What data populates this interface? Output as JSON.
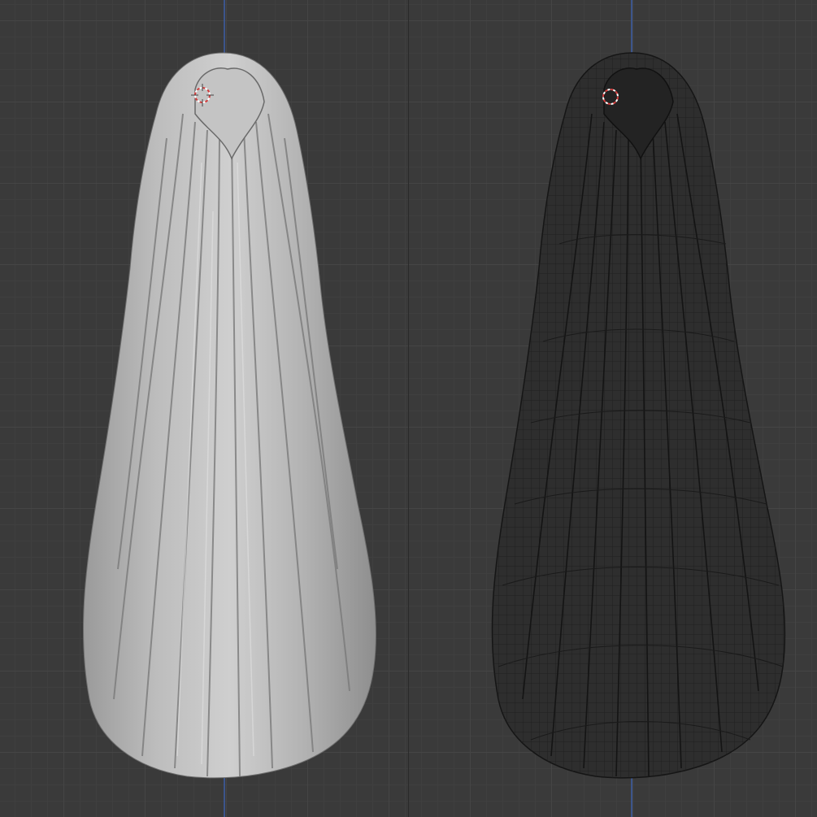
{
  "viewports": [
    {
      "name": "left",
      "shading": "solid",
      "model": "long-hair-mesh",
      "accent": "#bcbcbc"
    },
    {
      "name": "right",
      "shading": "wireframe",
      "model": "long-hair-mesh",
      "accent": "#2e2e2e"
    }
  ],
  "colors": {
    "background": "#3a3a3a",
    "grid_major": "#454545",
    "grid_minor": "#3f3f3f",
    "z_axis": "#3d5b9a",
    "cursor_red": "#d13c3c"
  },
  "icons": [
    "3d-cursor-icon"
  ]
}
